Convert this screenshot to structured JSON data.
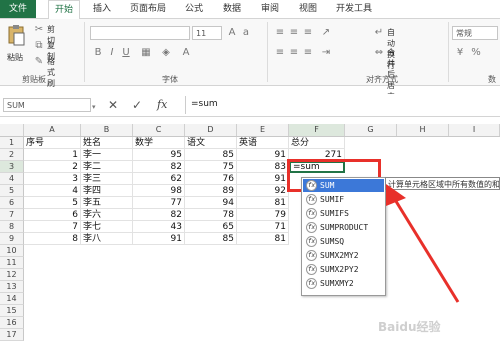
{
  "tabs": [
    "文件",
    "开始",
    "插入",
    "页面布局",
    "公式",
    "数据",
    "审阅",
    "视图",
    "开发工具"
  ],
  "ribbon": {
    "clipboard": {
      "paste": "粘贴",
      "cut": "剪切",
      "copy": "复制",
      "format_painter": "格式刷",
      "group": "剪贴板"
    },
    "font": {
      "size": "11",
      "group": "字体"
    },
    "alignment": {
      "wrap": "自动换行",
      "merge": "合并后居中",
      "group": "对齐方式"
    },
    "number": {
      "format": "常规",
      "group": "数"
    }
  },
  "formula_bar": {
    "name_box": "SUM",
    "cancel": "✕",
    "enter": "✓",
    "fx": "fx",
    "content": "=sum"
  },
  "columns": [
    "A",
    "B",
    "C",
    "D",
    "E",
    "F",
    "G",
    "H",
    "I"
  ],
  "rows": [
    "1",
    "2",
    "3",
    "4",
    "5",
    "6",
    "7",
    "8",
    "9",
    "10",
    "11",
    "12",
    "13",
    "14",
    "15",
    "16",
    "17"
  ],
  "table": {
    "headers": [
      "序号",
      "姓名",
      "数学",
      "语文",
      "英语",
      "总分"
    ],
    "data": [
      [
        "1",
        "李一",
        "95",
        "85",
        "91",
        "271"
      ],
      [
        "2",
        "李二",
        "82",
        "75",
        "83",
        ""
      ],
      [
        "3",
        "李三",
        "62",
        "76",
        "91",
        ""
      ],
      [
        "4",
        "李四",
        "98",
        "89",
        "92",
        ""
      ],
      [
        "5",
        "李五",
        "77",
        "94",
        "81",
        ""
      ],
      [
        "6",
        "李六",
        "82",
        "78",
        "79",
        ""
      ],
      [
        "7",
        "李七",
        "43",
        "65",
        "71",
        ""
      ],
      [
        "8",
        "李八",
        "91",
        "85",
        "81",
        ""
      ]
    ],
    "editing_cell": "=sum"
  },
  "autocomplete": {
    "items": [
      "SUM",
      "SUMIF",
      "SUMIFS",
      "SUMPRODUCT",
      "SUMSQ",
      "SUMX2MY2",
      "SUMX2PY2",
      "SUMXMY2"
    ],
    "selected_index": 0,
    "tooltip": "计算单元格区域中所有数值的和"
  },
  "colors": {
    "excel_green": "#217346",
    "selection": "#3c78d8",
    "highlight": "#e8302a"
  },
  "watermark": "Baidu经验"
}
